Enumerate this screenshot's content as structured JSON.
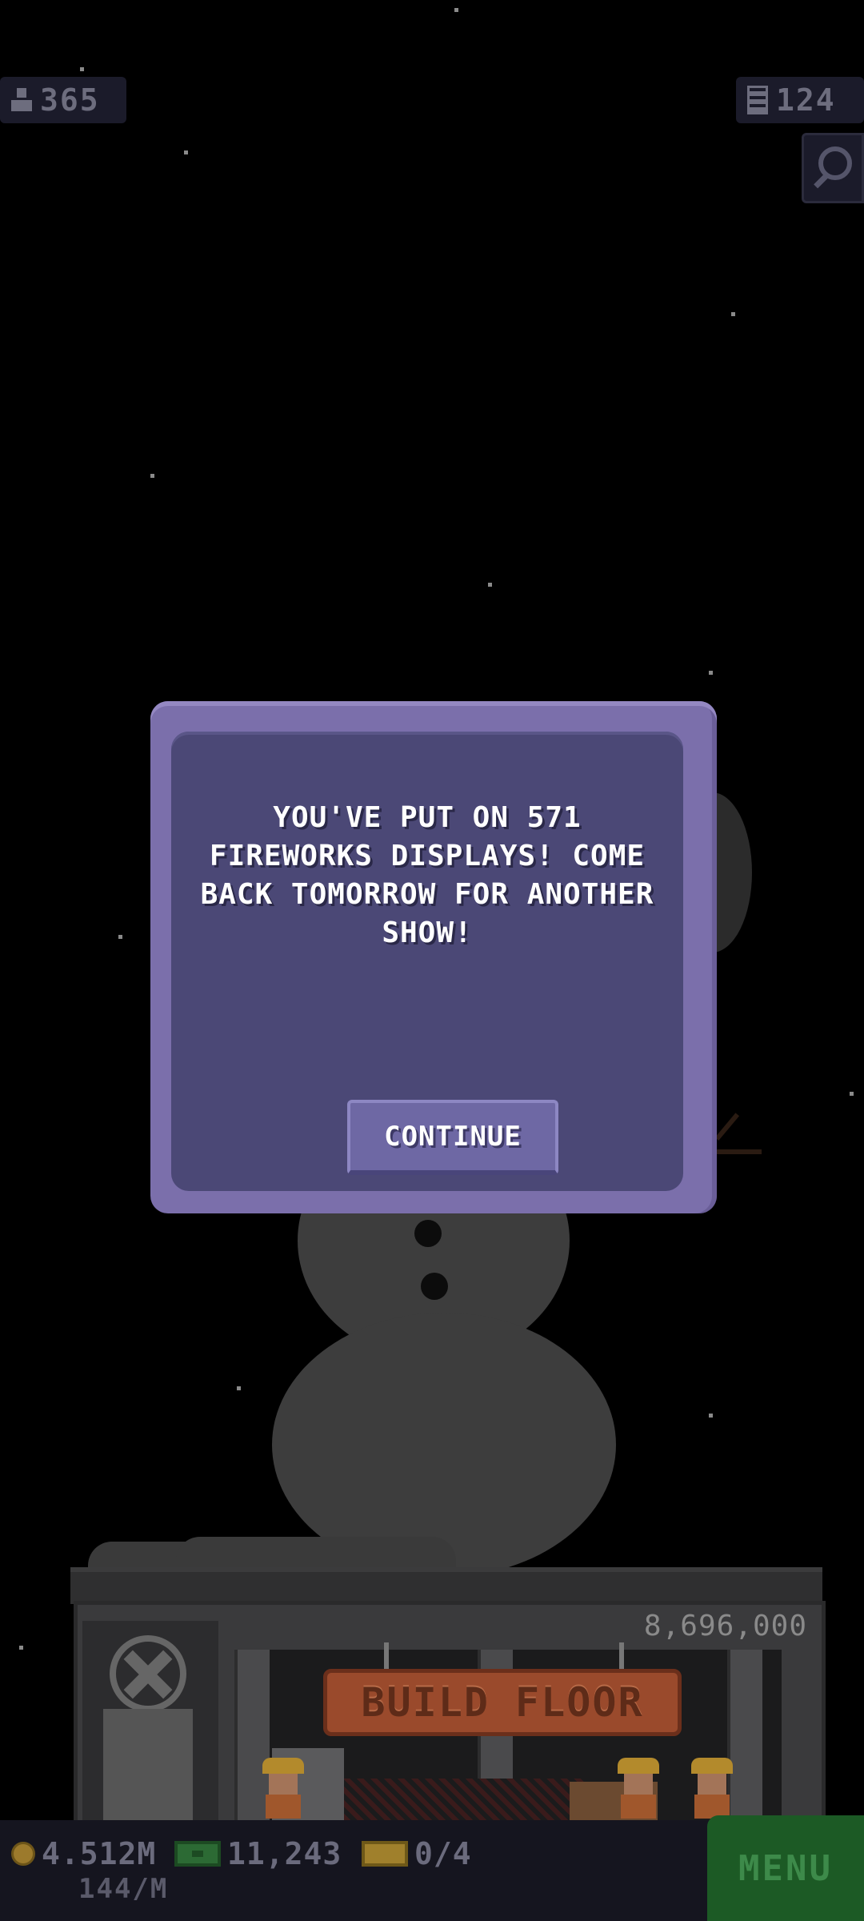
{
  "hud": {
    "population": "365",
    "floors": "124",
    "population_icon": "person-icon",
    "floors_icon": "building-icon",
    "search_icon": "search-icon"
  },
  "dialog": {
    "message": "YOU'VE PUT ON 571 FIREWORKS DISPLAYS! COME BACK TOMORROW FOR ANOTHER SHOW!",
    "continue_label": "CONTINUE"
  },
  "building": {
    "floor_cost": "8,696,000",
    "build_label": "BUILD FLOOR"
  },
  "bottom_bar": {
    "coins": "4.512M",
    "bux": "11,243",
    "tickets": "0/4",
    "rate": "144/M",
    "menu_label": "MENU"
  },
  "colors": {
    "dialog_frame": "#7b6fab",
    "dialog_fill": "#4b4876",
    "menu_green": "#1c5a25",
    "build_orange": "#9a4a2c"
  }
}
